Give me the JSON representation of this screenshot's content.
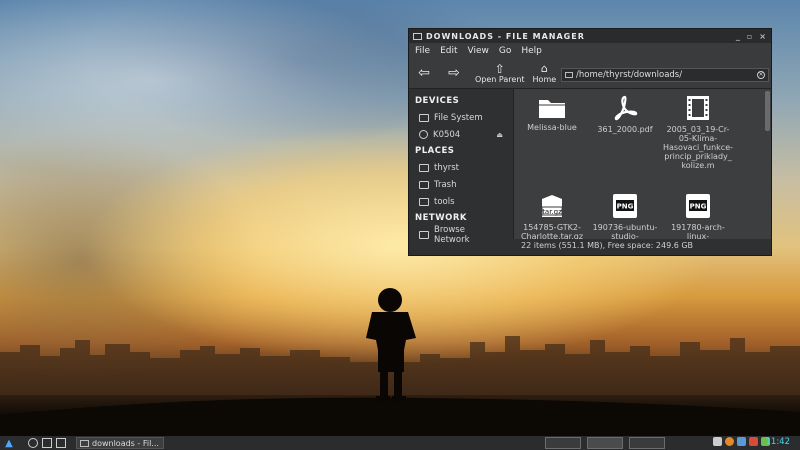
{
  "window": {
    "title": "DOWNLOADS - FILE MANAGER",
    "controls": [
      "_",
      "▫",
      "×"
    ]
  },
  "menu": [
    "File",
    "Edit",
    "View",
    "Go",
    "Help"
  ],
  "toolbar": {
    "back_icon": "back-arrow-icon",
    "forward_icon": "forward-arrow-icon",
    "parent_label": "Open Parent",
    "home_label": "Home",
    "path": "/home/thyrst/downloads/"
  },
  "sidebar": {
    "devices_heading": "DEVICES",
    "devices": [
      {
        "label": "File System",
        "icon": "drive-icon"
      },
      {
        "label": "K0504",
        "icon": "disc-icon",
        "eject": "⏏"
      }
    ],
    "places_heading": "PLACES",
    "places": [
      {
        "label": "thyrst",
        "icon": "folder-icon"
      },
      {
        "label": "Trash",
        "icon": "trash-icon"
      },
      {
        "label": "tools",
        "icon": "folder-icon"
      }
    ],
    "network_heading": "NETWORK",
    "network": [
      {
        "label": "Browse Network",
        "icon": "network-icon"
      }
    ]
  },
  "files": [
    {
      "name": "Melissa-blue",
      "icon": "folder-icon"
    },
    {
      "name": "361_2000.pdf",
      "icon": "pdf-icon"
    },
    {
      "name": "2005_03_19-Cr-05-Klima-Hasovaci_funkce-princip_priklady_kolize.m",
      "icon": "video-icon"
    },
    {
      "name": "154785-GTK2-Charlotte.tar.gz",
      "icon": "archive-icon",
      "badge": "tar.gz"
    },
    {
      "name": "190736-ubuntu-studio-",
      "icon": "image-icon",
      "badge": "PNG"
    },
    {
      "name": "191780-arch-linux-",
      "icon": "image-icon",
      "badge": "PNG"
    }
  ],
  "status": "22 items (551.1 MB), Free space: 249.6 GB",
  "taskbar": {
    "task_label": "downloads - Fil...",
    "clock": "11:42"
  }
}
